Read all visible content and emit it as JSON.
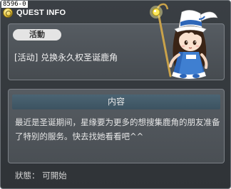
{
  "build": {
    "tag": "8596-0"
  },
  "window": {
    "title": "QUEST INFO",
    "icon": "quest-medal-icon"
  },
  "quest": {
    "category_badge": "活動",
    "title": "[活动] 兑换永久权圣诞鹿角"
  },
  "content": {
    "header": "内容",
    "description": "最近是圣诞期间，星缘要为更多的想搜集鹿角的朋友准备了特别的服务。快去找她看看吧^^"
  },
  "status": {
    "text": "狀態： 可開始"
  },
  "colors": {
    "window_bg": "#33383c",
    "panel_bg": "#505559",
    "header_bg": "#44596a",
    "badge_bg": "#e4e4e4",
    "npc_blue": "#2d66b8"
  }
}
